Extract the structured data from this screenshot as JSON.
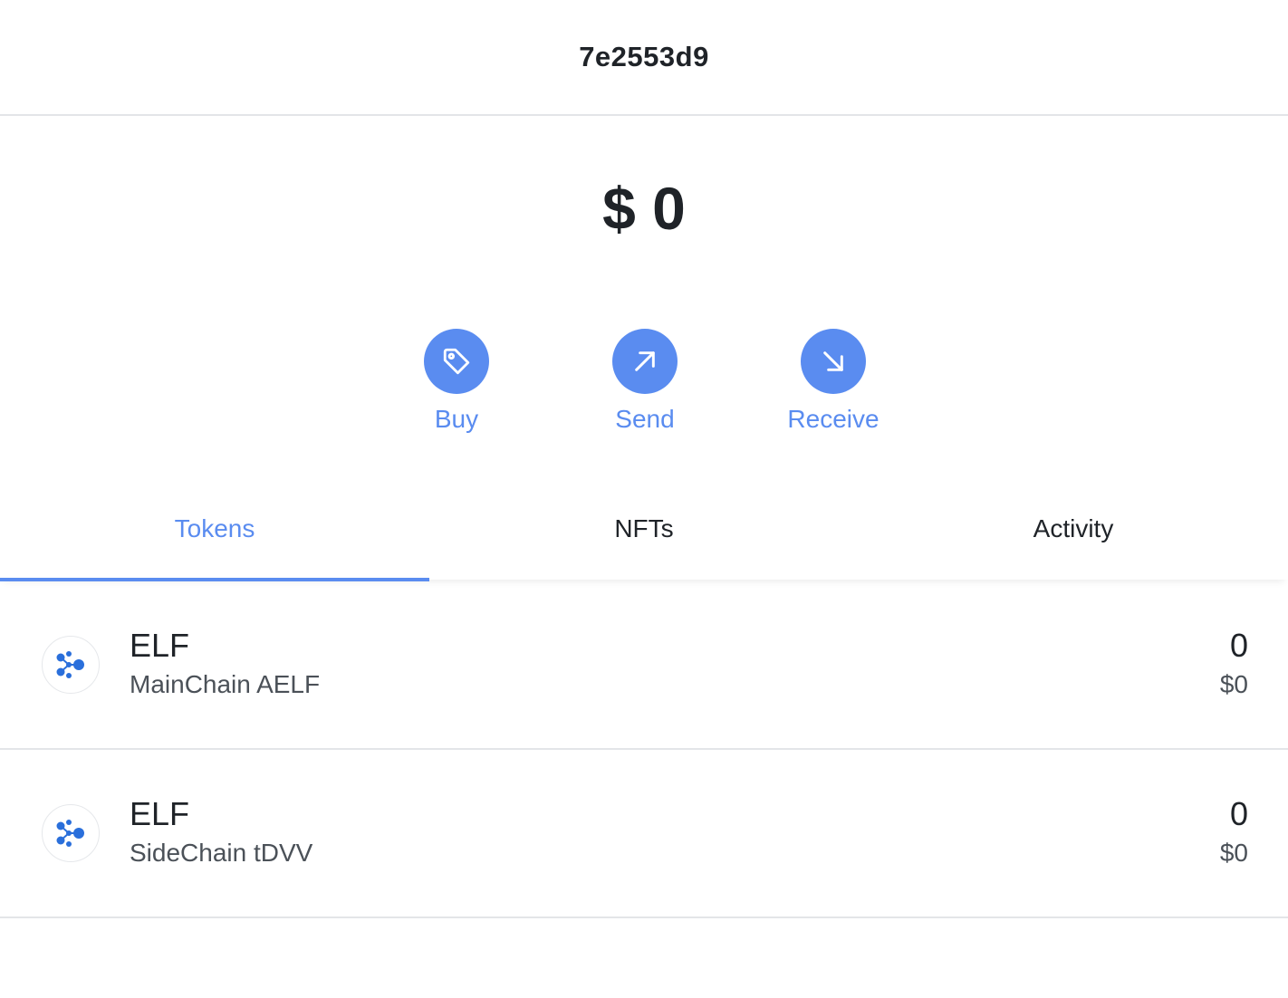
{
  "header": {
    "title": "7e2553d9"
  },
  "balance": {
    "display": "$ 0"
  },
  "actions": [
    {
      "label": "Buy",
      "icon": "tag-icon"
    },
    {
      "label": "Send",
      "icon": "arrow-up-right-icon"
    },
    {
      "label": "Receive",
      "icon": "arrow-down-right-icon"
    }
  ],
  "tabs": [
    {
      "label": "Tokens",
      "active": true
    },
    {
      "label": "NFTs",
      "active": false
    },
    {
      "label": "Activity",
      "active": false
    }
  ],
  "tokens": [
    {
      "symbol": "ELF",
      "chain": "MainChain AELF",
      "amount": "0",
      "value": "$0",
      "icon": "aelf-logo-icon"
    },
    {
      "symbol": "ELF",
      "chain": "SideChain tDVV",
      "amount": "0",
      "value": "$0",
      "icon": "aelf-logo-icon"
    }
  ],
  "colors": {
    "accent": "#5a8cf0",
    "text": "#1f2328",
    "subtext": "#4b5158",
    "divider": "#e3e5e8",
    "logo": "#2a6fdb"
  }
}
